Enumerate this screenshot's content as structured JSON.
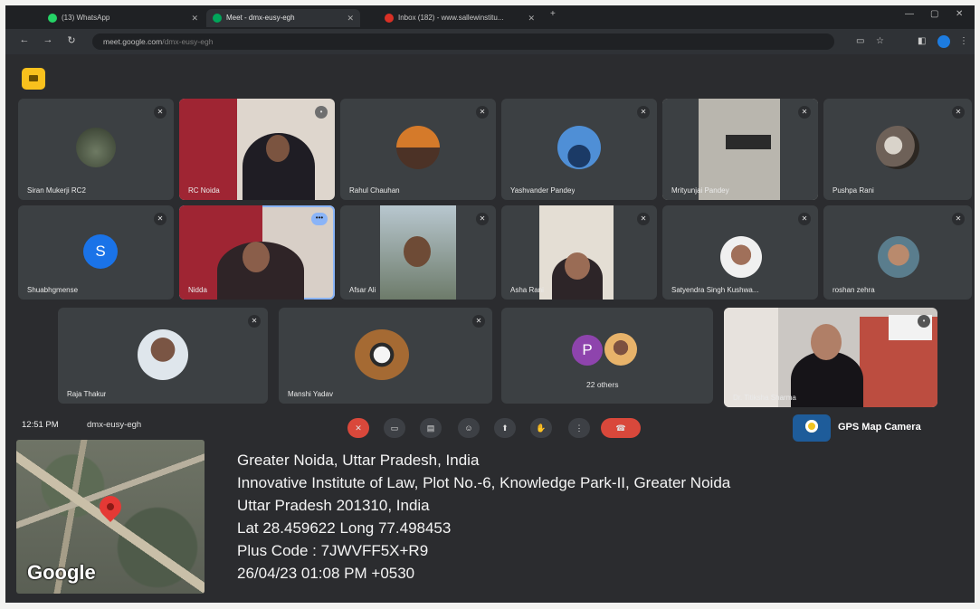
{
  "browser": {
    "tabs": [
      {
        "label": "(13) WhatsApp",
        "favicon_color": "#25d366"
      },
      {
        "label": "Meet - dmx-eusy-egh",
        "favicon_color": "#00a65a"
      },
      {
        "label": "Inbox (182) - www.sallewinstitu...",
        "favicon_color": "#d93025"
      }
    ],
    "url": "meet.google.com",
    "url_path": "/dmx-eusy-egh"
  },
  "meet": {
    "tiles_row1": [
      {
        "name": "Siran Mukerji RC2"
      },
      {
        "name": "RC Noida"
      },
      {
        "name": "Rahul Chauhan"
      },
      {
        "name": "Yashvander Pandey"
      },
      {
        "name": "Mrityunjai Pandey"
      },
      {
        "name": "Pushpa Rani"
      }
    ],
    "tiles_row2": [
      {
        "name": "Shuabhgmense",
        "initial": "S"
      },
      {
        "name": "Nidda"
      },
      {
        "name": "Afsar Ali"
      },
      {
        "name": "Asha Rani"
      },
      {
        "name": "Satyendra Singh Kushwa..."
      },
      {
        "name": "roshan zehra"
      }
    ],
    "tiles_row3": [
      {
        "name": "Raja Thakur"
      },
      {
        "name": "Manshi Yadav"
      },
      {
        "name": "22 others",
        "initial": "P"
      },
      {
        "name": "Dr. Titiksha Sharma"
      }
    ],
    "time": "12:51 PM",
    "meeting_code": "dmx-eusy-egh"
  },
  "overlay": {
    "app_label": "GPS Map Camera",
    "map_brand": "Google",
    "address_lines": [
      "Greater Noida, Uttar Pradesh, India",
      "Innovative Institute of Law, Plot No.-6, Knowledge Park-II, Greater Noida",
      "Uttar Pradesh 201310, India",
      "Lat 28.459622 Long 77.498453",
      "Plus Code : 7JWVFF5X+R9",
      "26/04/23 01:08 PM +0530"
    ]
  },
  "colors": {
    "tile_bg": "#3c4043",
    "end_call": "#d9483b",
    "meet_accent": "#8ab4f8",
    "avatar_S": "#1a73e8",
    "avatar_P": "#8e44ad"
  }
}
